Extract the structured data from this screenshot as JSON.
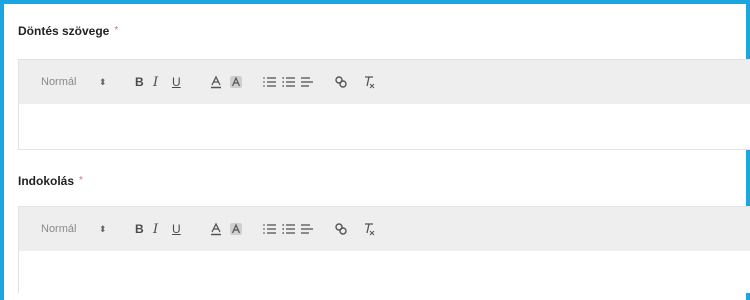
{
  "fields": [
    {
      "label": "Döntés szövege",
      "required_mark": "*",
      "toolbar": {
        "format_select": "Normál",
        "select_arrow": "⬍",
        "bold": "B",
        "italic": "I",
        "underline": "U"
      },
      "content": ""
    },
    {
      "label": "Indokolás",
      "required_mark": "*",
      "toolbar": {
        "format_select": "Normál",
        "select_arrow": "⬍",
        "bold": "B",
        "italic": "I",
        "underline": "U"
      },
      "content": ""
    }
  ],
  "colors": {
    "accent_border": "#1aa7e0",
    "toolbar_bg": "#eeeeee",
    "required": "#e07070"
  },
  "icons": [
    "text-color-icon",
    "background-color-icon",
    "ordered-list-icon",
    "bullet-list-icon",
    "align-icon",
    "link-icon",
    "clear-format-icon"
  ]
}
